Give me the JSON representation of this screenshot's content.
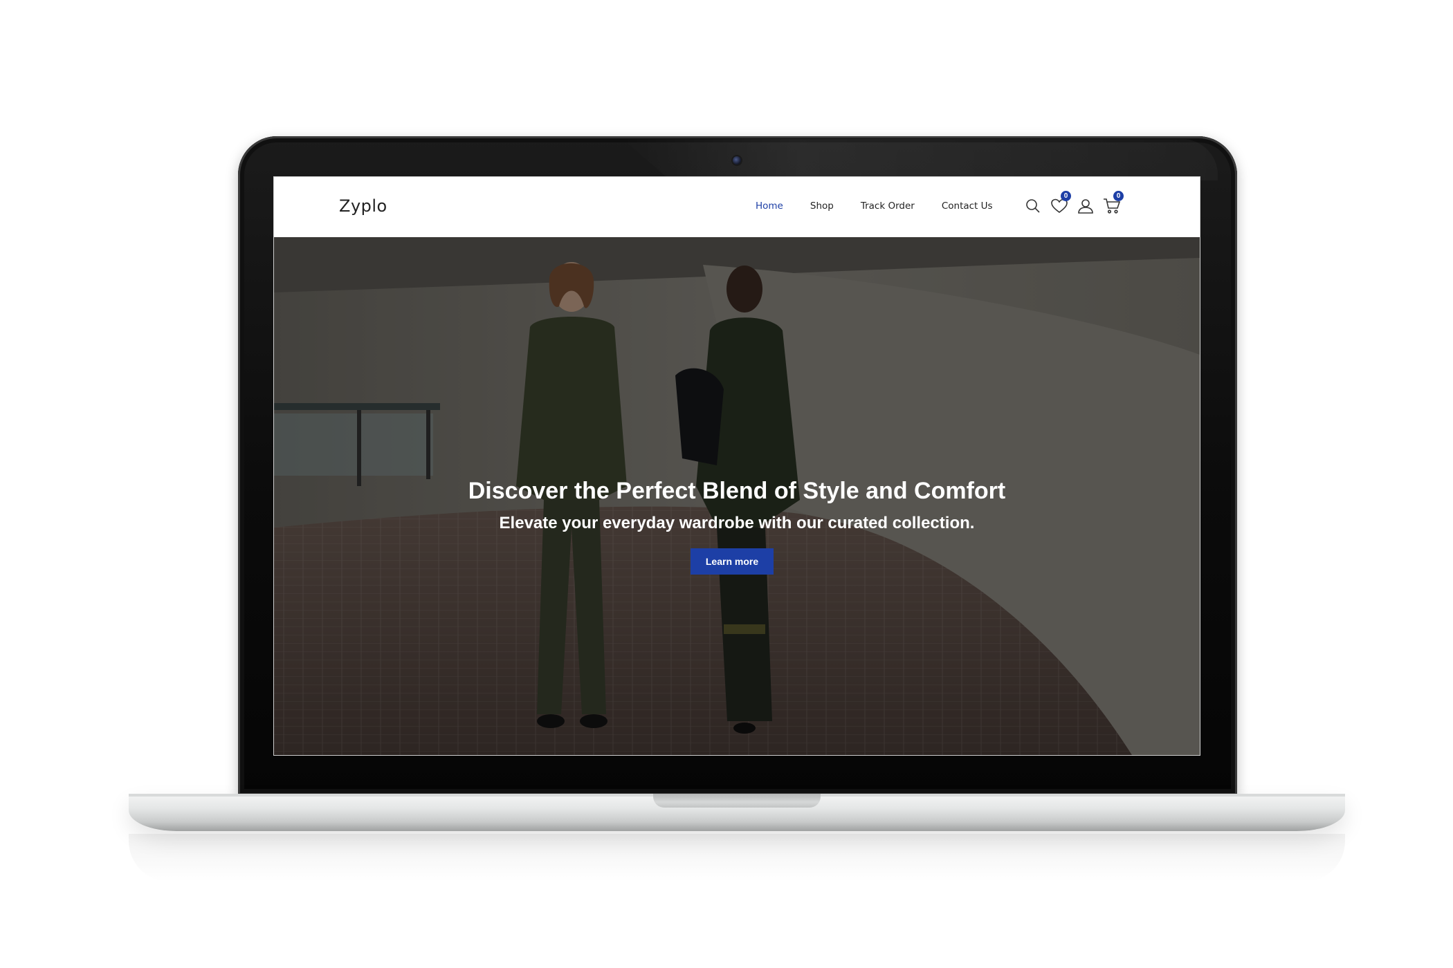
{
  "site": {
    "logo": "Zyplo"
  },
  "nav": {
    "links": [
      {
        "label": "Home",
        "active": true
      },
      {
        "label": "Shop",
        "active": false
      },
      {
        "label": "Track Order",
        "active": false
      },
      {
        "label": "Contact Us",
        "active": false
      }
    ],
    "icons": {
      "search": "search-icon",
      "wishlist": "heart-icon",
      "account": "user-icon",
      "cart": "cart-icon"
    },
    "wishlist_count": "0",
    "cart_count": "0"
  },
  "hero": {
    "title": "Discover the Perfect Blend of Style and Comfort",
    "subtitle": "Elevate your everyday wardrobe with our curated collection.",
    "button_label": "Learn more"
  },
  "colors": {
    "accent": "#1d3fa6",
    "nav_text": "#222222",
    "hero_text": "#ffffff"
  }
}
